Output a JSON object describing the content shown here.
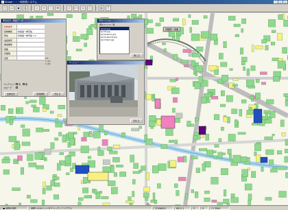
{
  "window": {
    "title": "Shape・・・地形図システム"
  },
  "toolbar": {
    "icons": [
      "new-icon",
      "open-icon",
      "save-icon",
      "print-icon",
      "search-icon",
      "zoom-in-icon",
      "zoom-out-icon",
      "pan-icon",
      "select-icon",
      "measure-icon",
      "layer-icon",
      "info-icon",
      "photo-icon",
      "help-icon"
    ]
  },
  "map": {
    "scale_label": "詳細図 / 地番"
  },
  "attr_panel": {
    "title": "属性表示 / 施設データ",
    "rows": [
      {
        "key": "建物番号",
        "value": ""
      },
      {
        "key": "建物種別",
        "value": "市営第一体育館"
      },
      {
        "key": "所在",
        "value": "市営第一体育館 1-2"
      },
      {
        "key": "電話番号",
        "value": ""
      },
      {
        "key": "構造種別",
        "value": ""
      },
      {
        "key": "階数",
        "value": ""
      },
      {
        "key": "床面積",
        "value": ""
      },
      {
        "key": "延床",
        "value": ""
      }
    ],
    "floor_values": [
      "2 4",
      "1 (小)",
      "1 (大)"
    ],
    "checks": [
      {
        "label": "有"
      },
      {
        "label": "無"
      }
    ],
    "check_labels": [
      "バリアフリー",
      "スロープ"
    ],
    "buttons": {
      "attr_all": "全体表示",
      "photo_show": "写真閲覧",
      "close": "閉じる"
    }
  },
  "files_win": {
    "title": "写真ファイル",
    "list_label": "添付ファイル一覧",
    "items": [
      "Gym1.jpg",
      "Gym2.jpg",
      "Gymnasium.jpg",
      "Gymnasium2.jpg",
      "Landmark.jpg"
    ],
    "close": "閉じる"
  },
  "preview_win": {
    "title": "プレビュー",
    "close": "閉じる"
  },
  "status": {
    "left": "■ 地図の操作",
    "mid": "地図上のポイントをクリックしてください",
    "coord_x": "37496451",
    "coord_y": "6511 1",
    "scale": "1 / 2500",
    "nums": [
      "5",
      "0"
    ]
  },
  "colors": {
    "building": "#8fd88f",
    "road": "#ffffff",
    "river": "#a8d4f0",
    "pink": "#f080c0",
    "yellow": "#f8f080",
    "purple": "#600080",
    "blue": "#2050c0"
  }
}
